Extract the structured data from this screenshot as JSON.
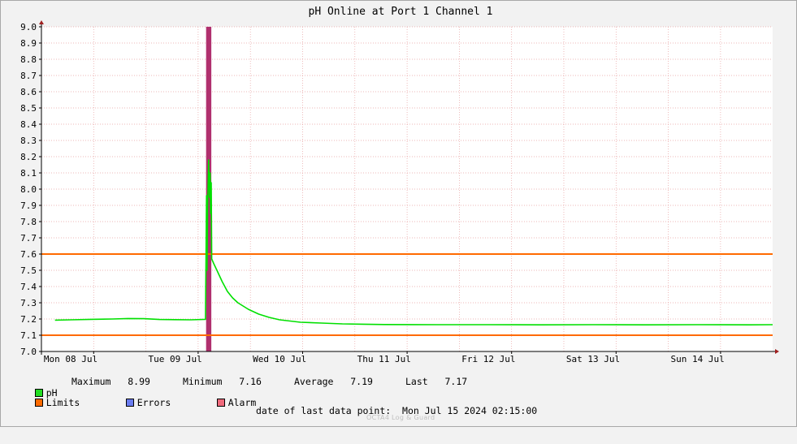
{
  "chart_data": {
    "type": "line",
    "title": "pH Online at Port 1 Channel 1",
    "ylim": [
      7.0,
      9.0
    ],
    "y_ticks": [
      "7.0",
      "7.1",
      "7.2",
      "7.3",
      "7.4",
      "7.5",
      "7.6",
      "7.7",
      "7.8",
      "7.9",
      "8.0",
      "8.1",
      "8.2",
      "8.3",
      "8.4",
      "8.5",
      "8.6",
      "8.7",
      "8.8",
      "8.9",
      "9.0"
    ],
    "x_tick_labels": [
      "Mon 08 Jul",
      "Tue 09 Jul",
      "Wed 10 Jul",
      "Thu 11 Jul",
      "Fri 12 Jul",
      "Sat 13 Jul",
      "Sun 14 Jul"
    ],
    "grid": true,
    "limits": {
      "upper": 7.6,
      "lower": 7.1,
      "color": "#ff6a00"
    },
    "alarm_band": {
      "start_day": 1.3,
      "end_day": 1.35,
      "color": "#b0306e"
    },
    "series": [
      {
        "name": "pH",
        "color": "#00e000",
        "points": [
          [
            -0.15,
            7.193
          ],
          [
            0.0,
            7.195
          ],
          [
            0.2,
            7.198
          ],
          [
            0.4,
            7.2
          ],
          [
            0.55,
            7.203
          ],
          [
            0.7,
            7.202
          ],
          [
            0.85,
            7.197
          ],
          [
            1.0,
            7.196
          ],
          [
            1.15,
            7.195
          ],
          [
            1.29,
            7.198
          ],
          [
            1.3,
            7.96
          ],
          [
            1.305,
            7.5
          ],
          [
            1.31,
            7.9
          ],
          [
            1.315,
            8.0
          ],
          [
            1.32,
            8.18
          ],
          [
            1.325,
            8.05
          ],
          [
            1.33,
            7.95
          ],
          [
            1.335,
            8.1
          ],
          [
            1.34,
            7.85
          ],
          [
            1.345,
            8.04
          ],
          [
            1.35,
            7.57
          ],
          [
            1.37,
            7.54
          ],
          [
            1.4,
            7.5
          ],
          [
            1.45,
            7.43
          ],
          [
            1.5,
            7.37
          ],
          [
            1.55,
            7.33
          ],
          [
            1.6,
            7.3
          ],
          [
            1.7,
            7.26
          ],
          [
            1.8,
            7.23
          ],
          [
            1.9,
            7.21
          ],
          [
            2.0,
            7.195
          ],
          [
            2.2,
            7.18
          ],
          [
            2.4,
            7.175
          ],
          [
            2.6,
            7.17
          ],
          [
            2.8,
            7.168
          ],
          [
            3.0,
            7.166
          ],
          [
            3.5,
            7.165
          ],
          [
            4.0,
            7.165
          ],
          [
            4.5,
            7.164
          ],
          [
            5.0,
            7.165
          ],
          [
            5.5,
            7.164
          ],
          [
            6.0,
            7.165
          ],
          [
            6.5,
            7.164
          ],
          [
            6.84,
            7.165
          ]
        ]
      }
    ],
    "stats": {
      "maximum": "8.99",
      "minimum": "7.16",
      "average": "7.19",
      "last": "7.17"
    }
  },
  "legend": {
    "ph_label": "pH",
    "ph_color": "#22dd22",
    "maximum_label": "Maximum",
    "minimum_label": "Minimum",
    "average_label": "Average",
    "last_label": "Last",
    "limits_label": "Limits",
    "limits_color": "#ff6a00",
    "errors_label": "Errors",
    "errors_color": "#6a7cf0",
    "alarm_label": "Alarm",
    "alarm_color": "#f06a7c"
  },
  "footer": {
    "last_point_label": "date of last data point:",
    "last_point_value": "Mon Jul 15 2024 02:15:00",
    "watermark": "OCTA4 Log & Guard"
  }
}
